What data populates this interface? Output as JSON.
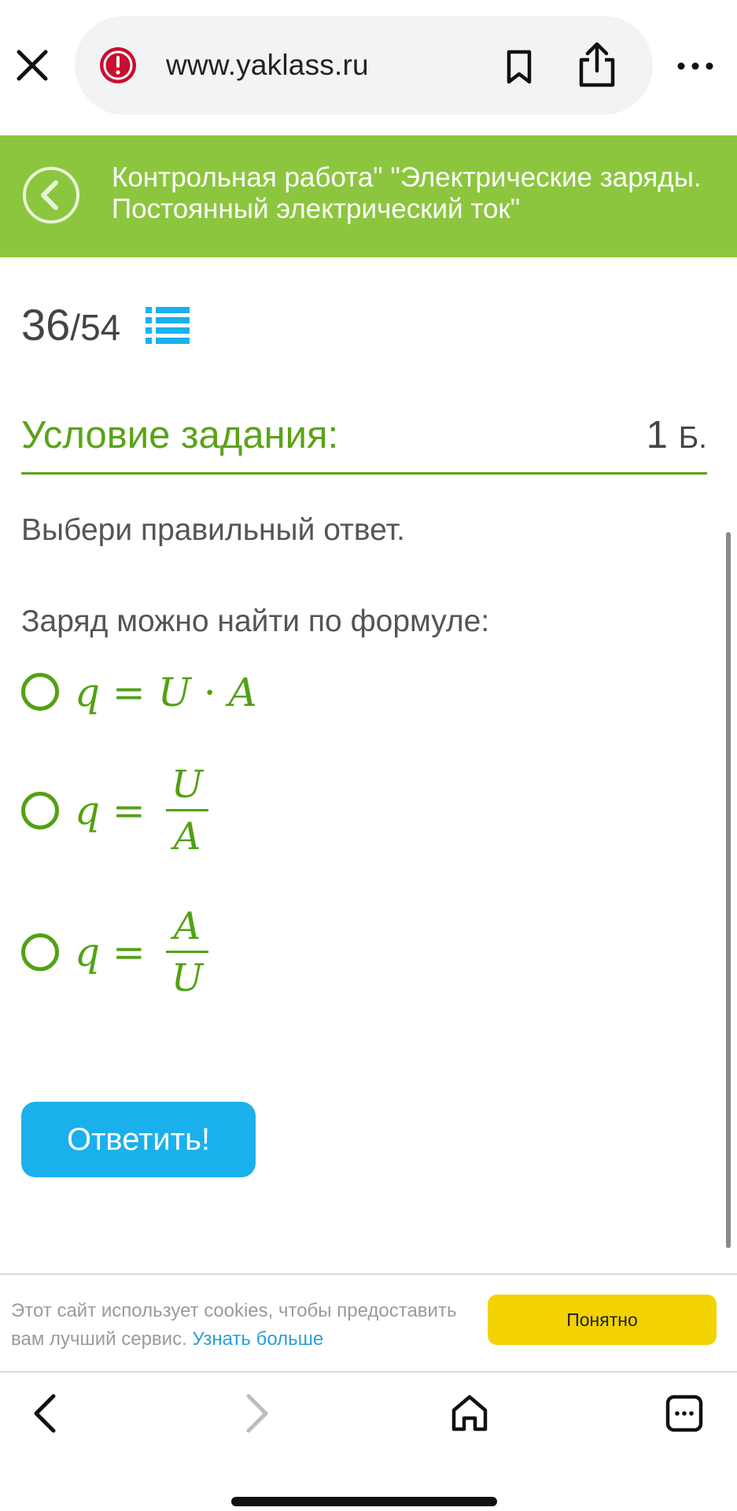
{
  "browser": {
    "url": "www.yaklass.ru"
  },
  "header": {
    "title_line1": "Контрольная работа\" \"Электрические заряды.",
    "title_line2": "Постоянный электрический ток\""
  },
  "progress": {
    "current": "36",
    "total": "/54"
  },
  "condition": {
    "title": "Условие задания:",
    "points": "1",
    "points_unit": "Б."
  },
  "instruction": "Выбери правильный ответ.",
  "question": "Заряд можно найти по формуле:",
  "options": [
    {
      "lhs": "q = ",
      "formula_a": "U",
      "op": " · ",
      "formula_b": "A"
    },
    {
      "lhs": "q = ",
      "numerator": "U",
      "denominator": "A"
    },
    {
      "lhs": "q = ",
      "numerator": "A",
      "denominator": "U"
    }
  ],
  "answer_button": "Ответить!",
  "cookie": {
    "text": "Этот сайт использует cookies, чтобы предоставить вам лучший сервис.",
    "link": "Узнать больше",
    "button": "Понятно"
  },
  "colors": {
    "header_green": "#8cc63f",
    "accent_green": "#5aa317",
    "button_blue": "#1ab0ec",
    "cookie_yellow": "#f2d200"
  },
  "icons": [
    "close-icon",
    "warning-icon",
    "bookmark-icon",
    "share-icon",
    "more-icon",
    "back-circle-icon",
    "list-icon",
    "nav-back-icon",
    "nav-forward-icon",
    "home-icon",
    "tabs-icon"
  ]
}
